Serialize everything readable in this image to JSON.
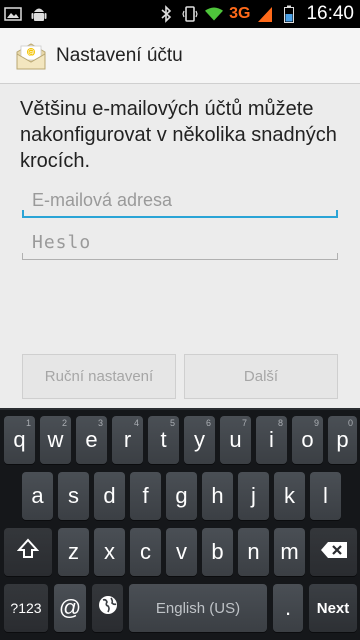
{
  "status_bar": {
    "network": "3G",
    "time": "16:40"
  },
  "action_bar": {
    "title": "Nastavení účtu"
  },
  "form": {
    "intro": "Většinu e-mailových účtů můžete nakonfigurovat v několika snadných krocích.",
    "email_placeholder": "E-mailová adresa",
    "password_placeholder": "Heslo",
    "manual_setup_label": "Ruční nastavení",
    "next_label": "Další"
  },
  "keyboard": {
    "row1": [
      {
        "key": "q",
        "hint": "1"
      },
      {
        "key": "w",
        "hint": "2"
      },
      {
        "key": "e",
        "hint": "3"
      },
      {
        "key": "r",
        "hint": "4"
      },
      {
        "key": "t",
        "hint": "5"
      },
      {
        "key": "y",
        "hint": "6"
      },
      {
        "key": "u",
        "hint": "7"
      },
      {
        "key": "i",
        "hint": "8"
      },
      {
        "key": "o",
        "hint": "9"
      },
      {
        "key": "p",
        "hint": "0"
      }
    ],
    "row2": [
      "a",
      "s",
      "d",
      "f",
      "g",
      "h",
      "j",
      "k",
      "l"
    ],
    "row3": [
      "z",
      "x",
      "c",
      "v",
      "b",
      "n",
      "m"
    ],
    "sym_label": "?123",
    "at_label": "@",
    "space_label": "English (US)",
    "period_label": ".",
    "action_label": "Next"
  },
  "colors": {
    "accent": "#2aa4d6",
    "network_3g": "#ff6a1a",
    "keyboard_bg": "#15171a"
  },
  "icons": {
    "status_left": [
      "picture-icon",
      "android-icon"
    ],
    "status_right": [
      "bluetooth-icon",
      "vibrate-icon",
      "wifi-icon",
      "signal-icon",
      "battery-icon"
    ],
    "app": "email-app-icon",
    "keyboard": [
      "shift-icon",
      "backspace-icon",
      "globe-icon"
    ]
  }
}
